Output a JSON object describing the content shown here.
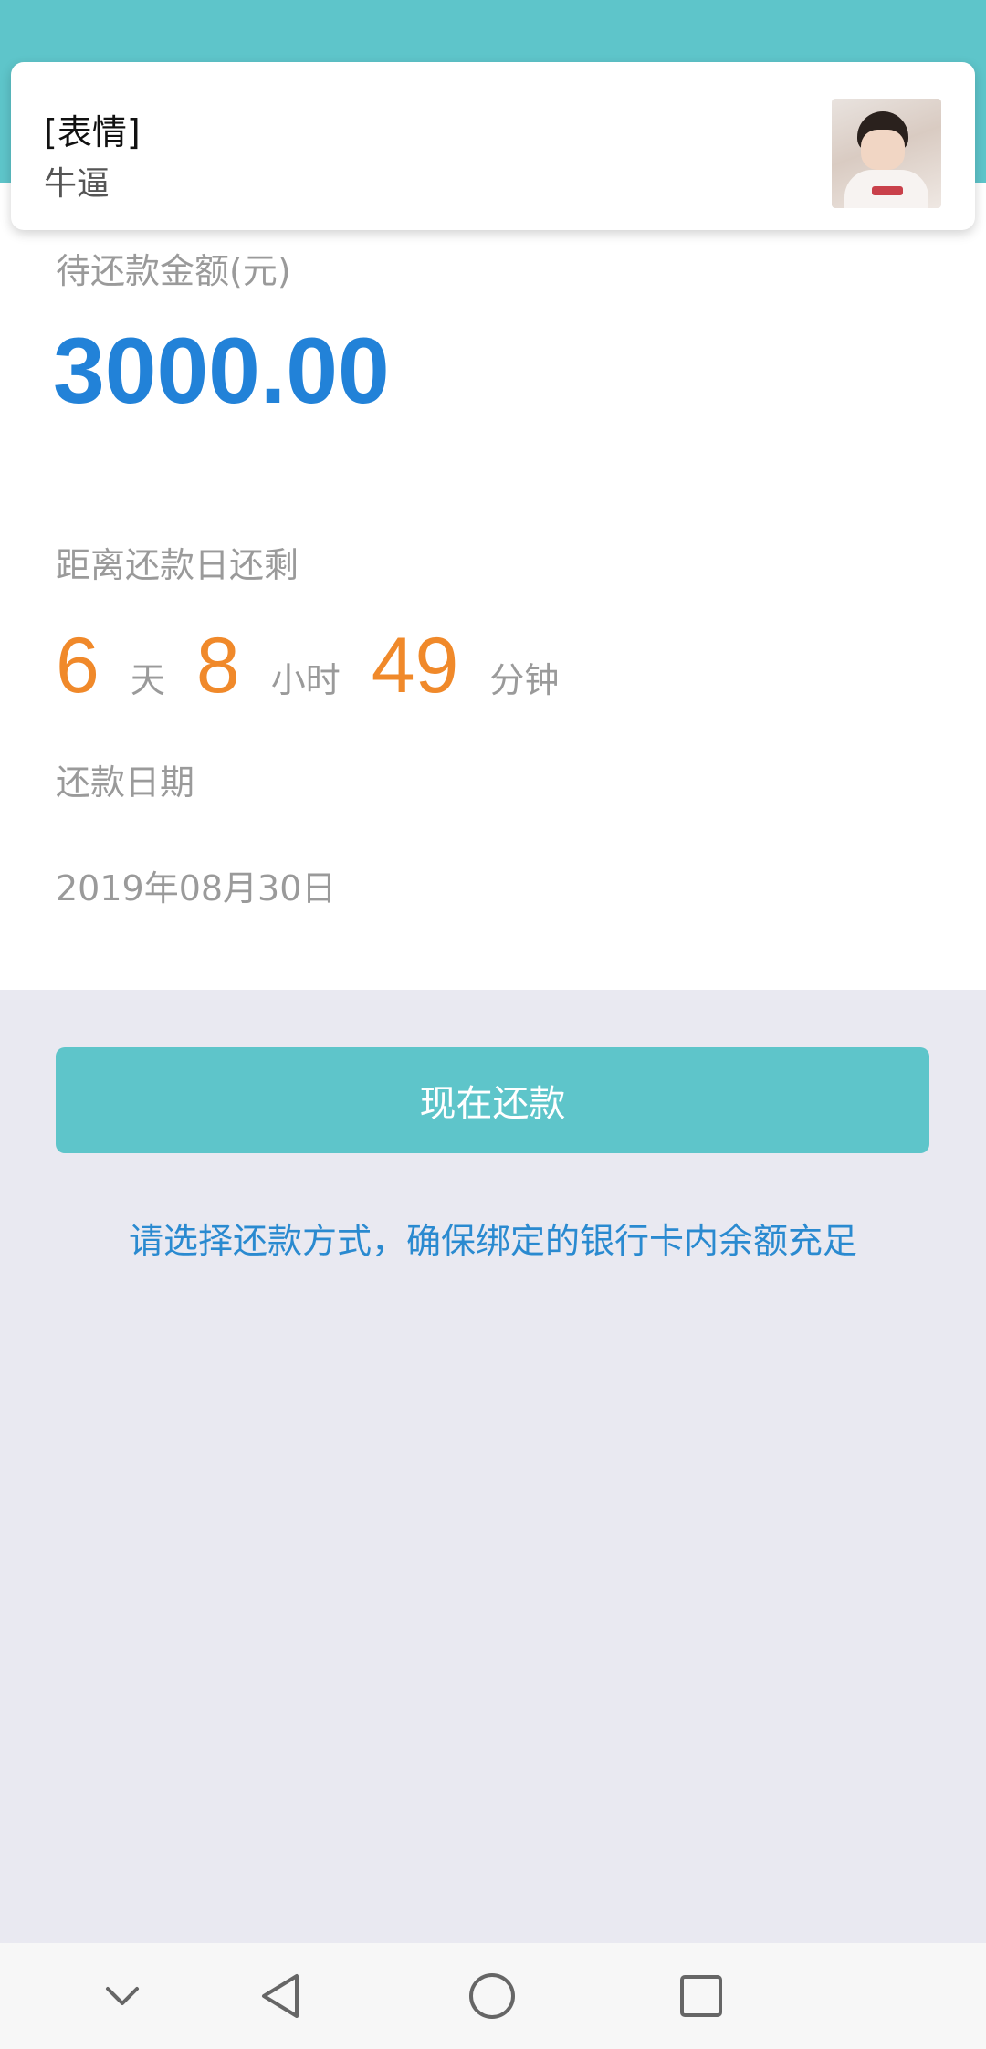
{
  "notification": {
    "title": "[表情]",
    "message": "牛逼"
  },
  "loan": {
    "amount_label": "待还款金额(元)",
    "amount": "3000.00",
    "countdown_label": "距离还款日还剩",
    "countdown": {
      "days": "6",
      "days_unit": "天",
      "hours": "8",
      "hours_unit": "小时",
      "minutes": "49",
      "minutes_unit": "分钟"
    },
    "due_date_label": "还款日期",
    "due_date": "2019年08月30日"
  },
  "actions": {
    "pay_now_label": "现在还款",
    "hint": "请选择还款方式，确保绑定的银行卡内余额充足"
  },
  "nav": {
    "icons": [
      "collapse-icon",
      "back-icon",
      "home-icon",
      "recents-icon"
    ]
  },
  "colors": {
    "accent": "#5ec5ca",
    "amount": "#2282d8",
    "countdown": "#f0892a",
    "hint": "#2a8ad0",
    "page_bg": "#e9e9f1"
  }
}
